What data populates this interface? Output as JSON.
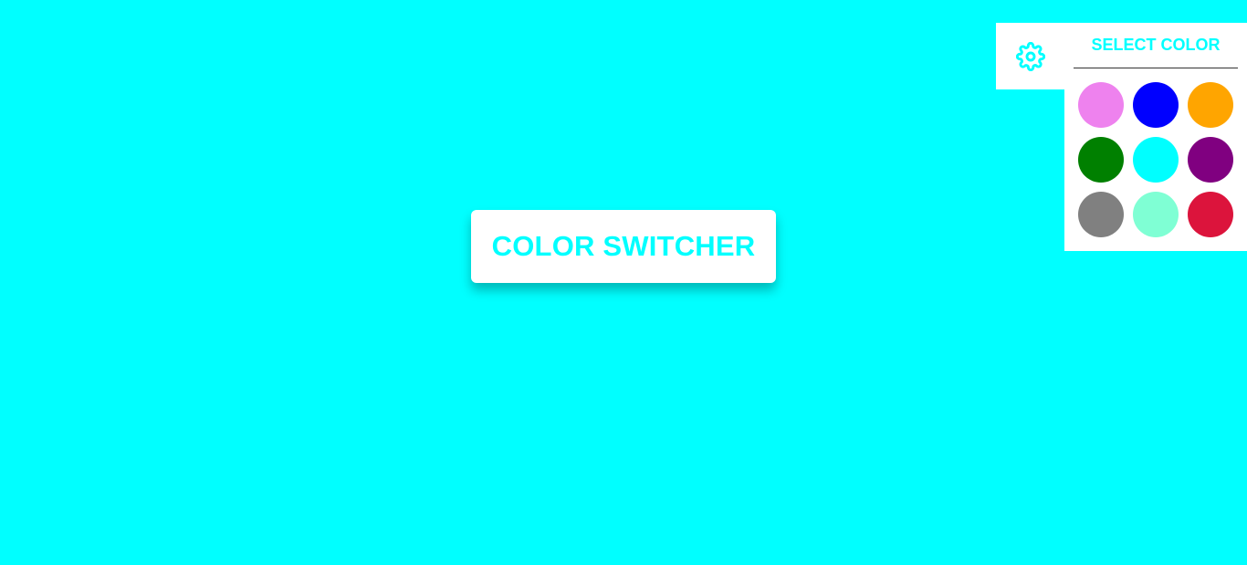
{
  "page": {
    "background_color": "#00ffff",
    "accent_color": "#00ffff"
  },
  "main": {
    "heading": "COLOR SWITCHER"
  },
  "settings": {
    "icon": "gear-icon"
  },
  "color_panel": {
    "title": "SELECT COLOR",
    "swatches": [
      {
        "name": "violet",
        "color": "#ee82ee"
      },
      {
        "name": "blue",
        "color": "#0000ff"
      },
      {
        "name": "orange",
        "color": "#ffa500"
      },
      {
        "name": "green",
        "color": "#008000"
      },
      {
        "name": "cyan",
        "color": "#00ffff"
      },
      {
        "name": "purple",
        "color": "#800080"
      },
      {
        "name": "gray",
        "color": "#808080"
      },
      {
        "name": "aquamarine",
        "color": "#7fffd4"
      },
      {
        "name": "crimson",
        "color": "#dc143c"
      }
    ]
  }
}
